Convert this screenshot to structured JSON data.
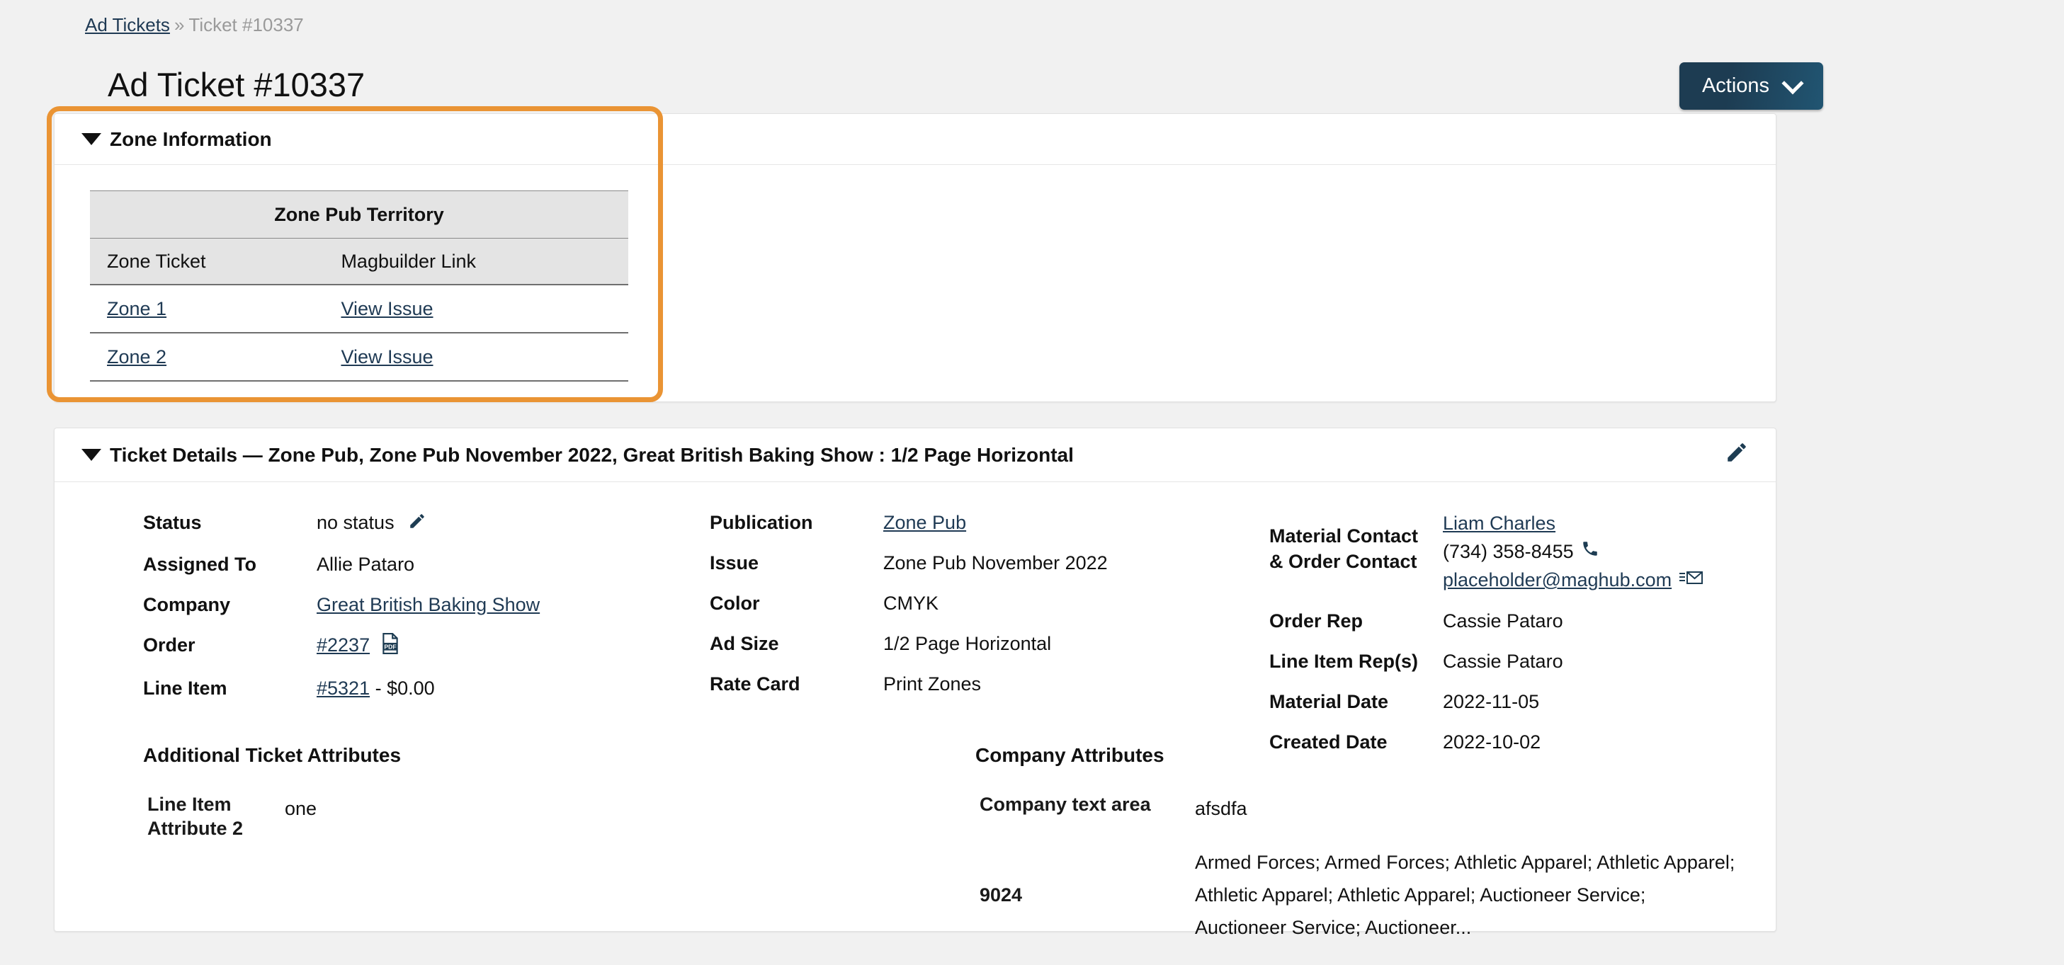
{
  "breadcrumb": {
    "root_label": "Ad Tickets",
    "separator": "»",
    "current_label": "Ticket #10337"
  },
  "page_title": "Ad Ticket #10337",
  "toolbar": {
    "actions_label": "Actions",
    "chevron_icon": "chevron-down-icon"
  },
  "zone_panel": {
    "header": "Zone Information",
    "caret_icon": "caret-down-icon",
    "table": {
      "group_header": "Zone Pub Territory",
      "columns": [
        "Zone Ticket",
        "Magbuilder Link"
      ],
      "rows": [
        {
          "zone_ticket": "Zone 1",
          "magbuilder_link": "View Issue"
        },
        {
          "zone_ticket": "Zone 2",
          "magbuilder_link": "View Issue"
        }
      ]
    },
    "highlight_color": "#ea9434"
  },
  "details_panel": {
    "header": "Ticket Details — Zone Pub, Zone Pub November 2022, Great British Baking Show : 1/2 Page Horizontal",
    "caret_icon": "caret-down-icon",
    "edit_icon": "pencil-icon",
    "column_1": [
      {
        "label": "Status",
        "value": "no status",
        "icon": "pencil-icon",
        "link": false
      },
      {
        "label": "Assigned To",
        "value": "Allie Pataro",
        "link": false
      },
      {
        "label": "Company",
        "value": "Great British Baking Show",
        "link": true
      },
      {
        "label": "Order",
        "value": "#2237",
        "link": true,
        "icon": "pdf-icon"
      },
      {
        "label": "Line Item",
        "value": "#5321",
        "link": true,
        "suffix": " - $0.00"
      }
    ],
    "column_2": [
      {
        "label": "Publication",
        "value": "Zone Pub",
        "link": true
      },
      {
        "label": "Issue",
        "value": "Zone Pub November 2022",
        "link": false
      },
      {
        "label": "Color",
        "value": "CMYK",
        "link": false
      },
      {
        "label": "Ad Size",
        "value": "1/2 Page Horizontal",
        "link": false
      },
      {
        "label": "Rate Card",
        "value": "Print Zones",
        "link": false
      }
    ],
    "contact": {
      "label_line_1": "Material Contact",
      "label_line_2": "& Order Contact",
      "name": "Liam Charles",
      "phone": "(734) 358-8455",
      "phone_icon": "phone-icon",
      "email": "placeholder@maghub.com",
      "email_icon": "envelope-icon"
    },
    "column_3": [
      {
        "label": "Order Rep",
        "value": "Cassie Pataro"
      },
      {
        "label": "Line Item Rep(s)",
        "value": "Cassie Pataro"
      },
      {
        "label": "Material Date",
        "value": "2022-11-05"
      },
      {
        "label": "Created Date",
        "value": "2022-10-02"
      }
    ],
    "ticket_attributes": {
      "title": "Additional Ticket Attributes",
      "rows": [
        {
          "label": "Line Item Attribute 2",
          "value": "one"
        }
      ]
    },
    "company_attributes": {
      "title": "Company Attributes",
      "rows": [
        {
          "label": "Company text area",
          "value": "afsdfa"
        },
        {
          "label": "9024",
          "value": "Armed Forces; Armed Forces; Athletic Apparel; Athletic Apparel; Athletic Apparel; Athletic Apparel; Auctioneer Service; Auctioneer Service; Auctioneer..."
        }
      ]
    }
  },
  "colors": {
    "link": "#1f3a54",
    "accent_orange": "#ea9434",
    "button_dark": "#1d3c52",
    "page_bg": "#f1f1f1"
  }
}
